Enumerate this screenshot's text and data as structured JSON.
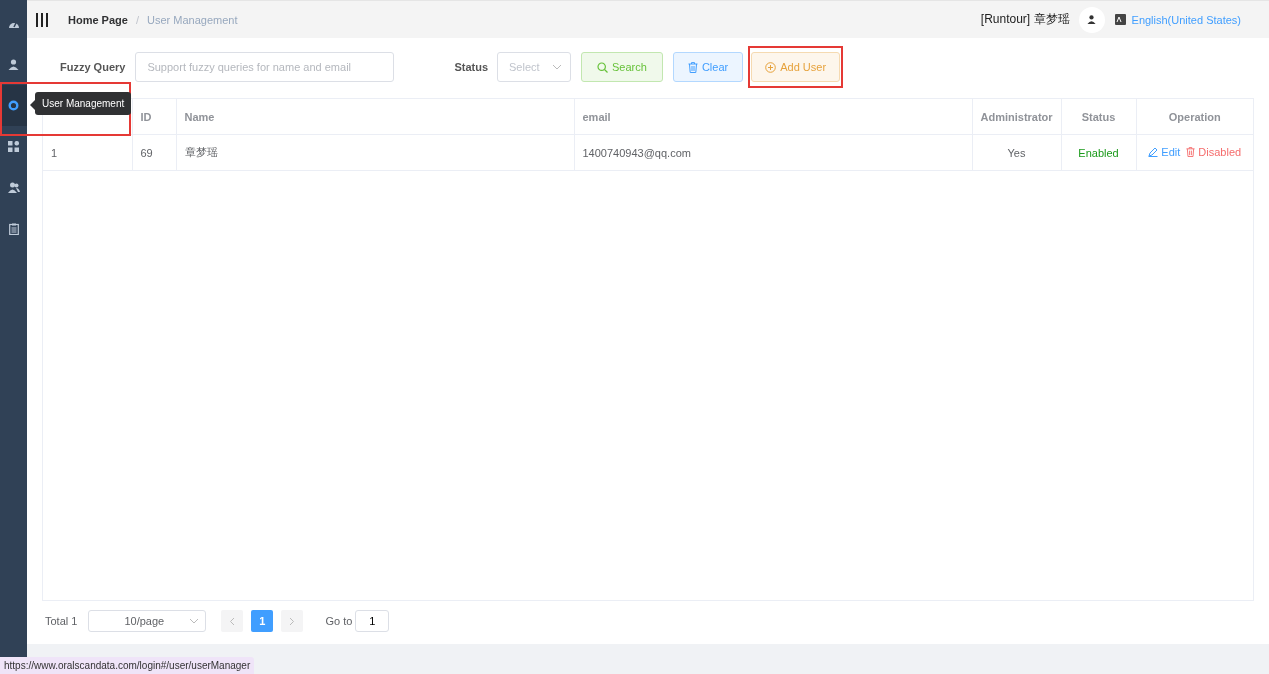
{
  "sidebar": {
    "items": [
      {
        "kind": "dashboard",
        "selected": false
      },
      {
        "kind": "user",
        "selected": false
      },
      {
        "kind": "ring",
        "selected": true
      },
      {
        "kind": "grid",
        "selected": false
      },
      {
        "kind": "users",
        "selected": false
      },
      {
        "kind": "clipboard",
        "selected": false
      }
    ]
  },
  "tooltip": "User Management",
  "header": {
    "breadcrumb": [
      "Home Page",
      "User Management"
    ],
    "separator": "/",
    "user": "[Runtour] 章梦瑶",
    "language": "English(United States)"
  },
  "filters": {
    "query_label": "Fuzzy Query",
    "query_placeholder": "Support fuzzy queries for name and email",
    "status_label": "Status",
    "status_placeholder": "Select",
    "buttons": [
      {
        "kind": "search",
        "label": "Search"
      },
      {
        "kind": "clear",
        "label": "Clear"
      },
      {
        "kind": "add",
        "label": "Add User"
      }
    ]
  },
  "table": {
    "columns": [
      {},
      {
        "label": "ID"
      },
      {
        "label": "Name"
      },
      {
        "label": "email"
      },
      {
        "label": "Administrator"
      },
      {
        "label": "Status"
      },
      {
        "label": "Operation"
      }
    ],
    "rows": [
      {
        "serial": "1",
        "id": "69",
        "name": "章梦瑶",
        "email": "1400740943@qq.com",
        "admin": "Yes",
        "status": "Enabled",
        "enabled": true,
        "actions": [
          {
            "kind": "edit",
            "label": "Edit"
          },
          {
            "kind": "delete",
            "label": "Disabled"
          }
        ]
      }
    ]
  },
  "pagination": {
    "total": "Total 1",
    "page_size": "10/page",
    "pages": [
      {
        "label": "1",
        "selected": true
      }
    ],
    "goto_label": "Go to",
    "goto_value": "1"
  },
  "status_bar": "https://www.oralscandata.com/login#/user/userManager"
}
